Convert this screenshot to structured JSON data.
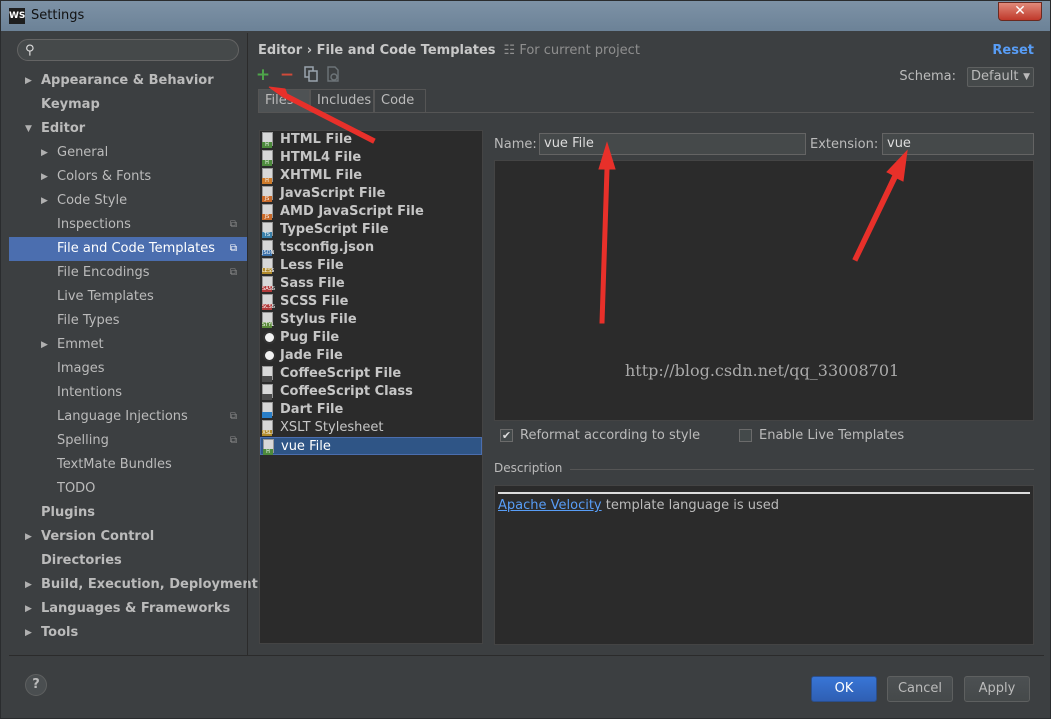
{
  "window": {
    "title": "Settings",
    "logo_text": "WS",
    "close_glyph": "✕"
  },
  "search": {
    "placeholder": ""
  },
  "tree": [
    {
      "label": "Appearance & Behavior",
      "level": 0,
      "arrow": "▶",
      "bold": true
    },
    {
      "label": "Keymap",
      "level": 0,
      "arrow": "",
      "bold": true
    },
    {
      "label": "Editor",
      "level": 0,
      "arrow": "▼",
      "bold": true
    },
    {
      "label": "General",
      "level": 1,
      "arrow": "▶"
    },
    {
      "label": "Colors & Fonts",
      "level": 1,
      "arrow": "▶"
    },
    {
      "label": "Code Style",
      "level": 1,
      "arrow": "▶"
    },
    {
      "label": "Inspections",
      "level": 1,
      "arrow": "",
      "proj": true
    },
    {
      "label": "File and Code Templates",
      "level": 1,
      "arrow": "",
      "proj": true,
      "selected": true
    },
    {
      "label": "File Encodings",
      "level": 1,
      "arrow": "",
      "proj": true
    },
    {
      "label": "Live Templates",
      "level": 1,
      "arrow": ""
    },
    {
      "label": "File Types",
      "level": 1,
      "arrow": ""
    },
    {
      "label": "Emmet",
      "level": 1,
      "arrow": "▶"
    },
    {
      "label": "Images",
      "level": 1,
      "arrow": ""
    },
    {
      "label": "Intentions",
      "level": 1,
      "arrow": ""
    },
    {
      "label": "Language Injections",
      "level": 1,
      "arrow": "",
      "proj": true
    },
    {
      "label": "Spelling",
      "level": 1,
      "arrow": "",
      "proj": true
    },
    {
      "label": "TextMate Bundles",
      "level": 1,
      "arrow": ""
    },
    {
      "label": "TODO",
      "level": 1,
      "arrow": ""
    },
    {
      "label": "Plugins",
      "level": 0,
      "arrow": "",
      "bold": true
    },
    {
      "label": "Version Control",
      "level": 0,
      "arrow": "▶",
      "bold": true
    },
    {
      "label": "Directories",
      "level": 0,
      "arrow": "",
      "bold": true
    },
    {
      "label": "Build, Execution, Deployment",
      "level": 0,
      "arrow": "▶",
      "bold": true
    },
    {
      "label": "Languages & Frameworks",
      "level": 0,
      "arrow": "▶",
      "bold": true
    },
    {
      "label": "Tools",
      "level": 0,
      "arrow": "▶",
      "bold": true
    }
  ],
  "header": {
    "breadcrumb": "Editor › File and Code Templates",
    "scope": "For current project",
    "reset": "Reset"
  },
  "toolbar": {
    "add": "+",
    "remove": "−"
  },
  "schema": {
    "label": "Schema:",
    "value": "Default"
  },
  "tabs": [
    "Files",
    "Includes",
    "Code"
  ],
  "files": [
    {
      "name": "HTML File",
      "badge": "H",
      "color": "#4d8a3c",
      "bold": true
    },
    {
      "name": "HTML4 File",
      "badge": "H",
      "color": "#4d8a3c",
      "bold": true
    },
    {
      "name": "XHTML File",
      "badge": "H",
      "color": "#cc7a2a",
      "bold": true
    },
    {
      "name": "JavaScript File",
      "badge": "JS",
      "color": "#c86a2a",
      "bold": true
    },
    {
      "name": "AMD JavaScript File",
      "badge": "JS",
      "color": "#c86a2a",
      "bold": true
    },
    {
      "name": "TypeScript File",
      "badge": "TS",
      "color": "#3a7fa8",
      "bold": true
    },
    {
      "name": "tsconfig.json",
      "badge": "JSON",
      "color": "#3a6fa8",
      "bold": true
    },
    {
      "name": "Less File",
      "badge": "LESS",
      "color": "#b08a2a",
      "bold": true
    },
    {
      "name": "Sass File",
      "badge": "SASS",
      "color": "#b03a3a",
      "bold": true
    },
    {
      "name": "SCSS File",
      "badge": "SCSS",
      "color": "#b03a3a",
      "bold": true
    },
    {
      "name": "Stylus File",
      "badge": "STYL",
      "color": "#5a8a3a",
      "bold": true
    },
    {
      "name": "Pug File",
      "badge": "",
      "color": "",
      "circle": true,
      "bold": true
    },
    {
      "name": "Jade File",
      "badge": "",
      "color": "",
      "circle": true,
      "bold": true
    },
    {
      "name": "CoffeeScript File",
      "badge": "",
      "color": "#4a4a4a",
      "bold": true
    },
    {
      "name": "CoffeeScript Class",
      "badge": "",
      "color": "#4a4a4a",
      "bold": true
    },
    {
      "name": "Dart File",
      "badge": "",
      "color": "#2a7fc8",
      "bold": true
    },
    {
      "name": "XSLT Stylesheet",
      "badge": "XSL",
      "color": "#b08a2a",
      "bold": false
    },
    {
      "name": "vue File",
      "badge": "H",
      "color": "#4d8a3c",
      "bold": false,
      "selected": true
    }
  ],
  "form": {
    "name_label": "Name:",
    "name_value": "vue File",
    "extension_label": "Extension:",
    "extension_value": "vue"
  },
  "editor": {
    "watermark": "http://blog.csdn.net/qq_33008701"
  },
  "options": {
    "reformat_label": "Reformat according to style",
    "reformat_checked": true,
    "live_label": "Enable Live Templates",
    "live_checked": false
  },
  "description": {
    "label": "Description",
    "link": "Apache Velocity",
    "text": " template language is used"
  },
  "footer": {
    "help": "?",
    "ok": "OK",
    "cancel": "Cancel",
    "apply": "Apply"
  },
  "colors": {
    "accent": "#4b6eaf",
    "link": "#589df6",
    "annotation": "#e8302a"
  }
}
